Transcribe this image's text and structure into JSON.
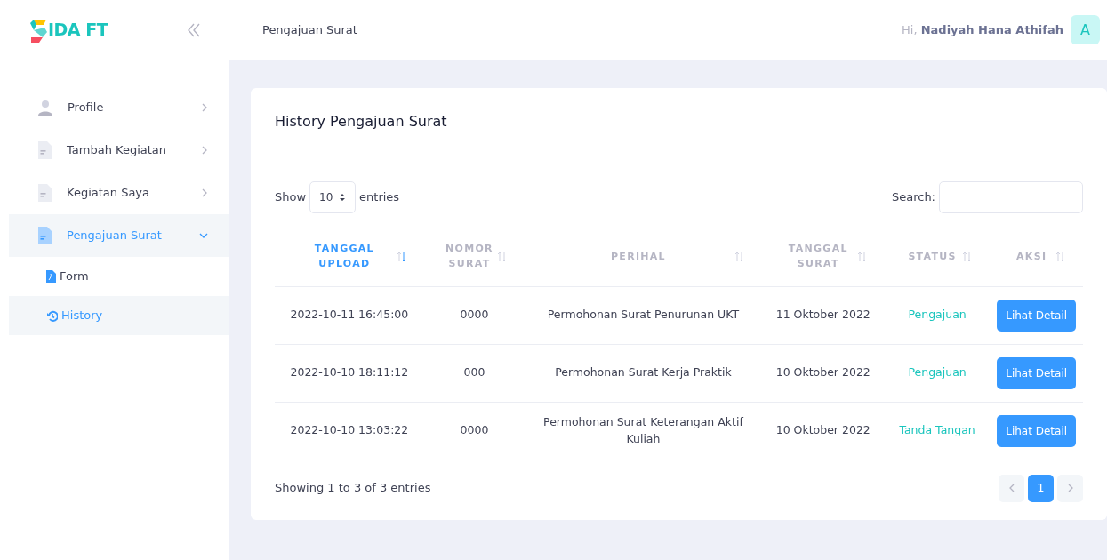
{
  "brand": {
    "name": "IDA FT"
  },
  "sidebar": {
    "items": [
      {
        "label": "Profile",
        "kind": "user",
        "expanded": false,
        "active": false
      },
      {
        "label": "Tambah Kegiatan",
        "kind": "doc",
        "expanded": false,
        "active": false
      },
      {
        "label": "Kegiatan Saya",
        "kind": "doc",
        "expanded": false,
        "active": false
      },
      {
        "label": "Pengajuan Surat",
        "kind": "doc",
        "expanded": true,
        "active": true,
        "children": [
          {
            "label": "Form",
            "kind": "pdf",
            "selected": false
          },
          {
            "label": "History",
            "kind": "history",
            "selected": true
          }
        ]
      }
    ]
  },
  "header": {
    "title": "Pengajuan Surat",
    "greeting": "Hi,",
    "user_name": "Nadiyah Hana Athifah",
    "avatar": "A"
  },
  "card": {
    "title": "History Pengajuan Surat",
    "length": {
      "before": "Show",
      "value": "10",
      "after": "entries"
    },
    "search": {
      "label": "Search:"
    },
    "table": {
      "columns": [
        {
          "label": "TANGGAL UPLOAD",
          "sorted": true
        },
        {
          "label": "NOMOR SURAT",
          "sorted": false
        },
        {
          "label": "PERIHAL",
          "sorted": false
        },
        {
          "label": "TANGGAL SURAT",
          "sorted": false
        },
        {
          "label": "STATUS",
          "sorted": false
        },
        {
          "label": "AKSI",
          "sorted": false
        }
      ],
      "rows": [
        {
          "upload": "2022-10-11 16:45:00",
          "nomor": "0000",
          "perihal": "Permohonan Surat Penurunan UKT",
          "tanggal": "11 Oktober 2022",
          "status": "Pengajuan",
          "action": "Lihat Detail"
        },
        {
          "upload": "2022-10-10 18:11:12",
          "nomor": "000",
          "perihal": "Permohonan Surat Kerja Praktik",
          "tanggal": "10 Oktober 2022",
          "status": "Pengajuan",
          "action": "Lihat Detail"
        },
        {
          "upload": "2022-10-10 13:03:22",
          "nomor": "0000",
          "perihal": "Permohonan Surat Keterangan Aktif Kuliah",
          "tanggal": "10 Oktober 2022",
          "status": "Tanda Tangan",
          "action": "Lihat Detail"
        }
      ]
    },
    "info": "Showing 1 to 3 of 3 entries",
    "pagination": {
      "pages": [
        {
          "label": "1",
          "selected": true
        }
      ],
      "prev_disabled": true,
      "next_disabled": true
    }
  }
}
